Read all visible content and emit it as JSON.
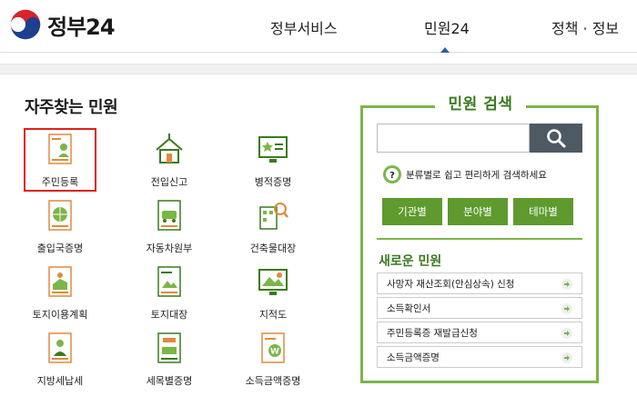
{
  "header": {
    "logo_text": "정부24",
    "nav": [
      "정부서비스",
      "민원24",
      "정책 · 정보"
    ],
    "active_index": 1
  },
  "frequent": {
    "title": "자주찾는 민원",
    "items": [
      {
        "label": "주민등록",
        "icon": "resident-card-icon"
      },
      {
        "label": "전입신고",
        "icon": "house-move-icon"
      },
      {
        "label": "병적증명",
        "icon": "military-record-icon"
      },
      {
        "label": "출입국증명",
        "icon": "globe-document-icon"
      },
      {
        "label": "자동차원부",
        "icon": "car-document-icon"
      },
      {
        "label": "건축물대장",
        "icon": "building-search-icon"
      },
      {
        "label": "토지이용계획",
        "icon": "land-plan-icon"
      },
      {
        "label": "토지대장",
        "icon": "land-register-icon"
      },
      {
        "label": "지적도",
        "icon": "cadastral-map-icon"
      },
      {
        "label": "지방세납세",
        "icon": "local-tax-icon"
      },
      {
        "label": "세목별증명",
        "icon": "tax-item-icon"
      },
      {
        "label": "소득금액증명",
        "icon": "income-certificate-icon"
      }
    ]
  },
  "search": {
    "title": "민원 검색",
    "input_value": "",
    "hint": "분류별로 쉽고 편리하게 검색하세요",
    "tabs": [
      "기관별",
      "분야별",
      "테마별"
    ]
  },
  "new_services": {
    "title": "새로운 민원",
    "items": [
      "사망자 재산조회(안심상속) 신청",
      "소득확인서",
      "주민등록증 재발급신청",
      "소득금액증명"
    ]
  },
  "colors": {
    "green": "#7ab648",
    "dark_green": "#3a7a1e",
    "tab_green": "#5e9a2e",
    "search_button": "#4d5a63",
    "highlight_red": "#e0201c"
  }
}
